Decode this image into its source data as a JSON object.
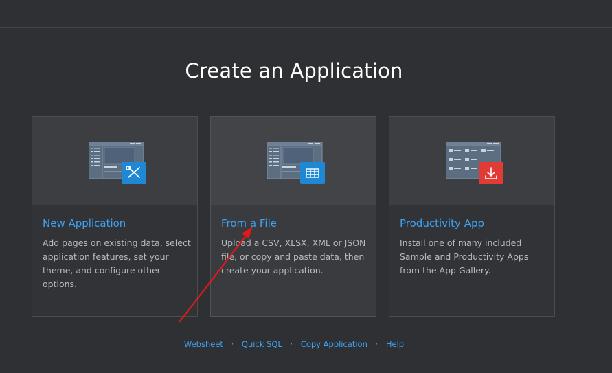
{
  "page": {
    "title": "Create an Application"
  },
  "cards": [
    {
      "title": "New Application",
      "description": "Add pages on existing data, select application features, set your theme, and configure other options.",
      "icon": "pencil-ruler-icon",
      "badge_color": "#1e88d4"
    },
    {
      "title": "From a File",
      "description": "Upload a CSV, XLSX, XML or JSON file, or copy and paste data, then create your application.",
      "icon": "table-grid-icon",
      "badge_color": "#1e88d4"
    },
    {
      "title": "Productivity App",
      "description": "Install one of many included Sample and Productivity Apps from the App Gallery.",
      "icon": "download-icon",
      "badge_color": "#e03b35"
    }
  ],
  "footer": {
    "links": [
      "Websheet",
      "Quick SQL",
      "Copy Application",
      "Help"
    ],
    "separator": "·"
  },
  "colors": {
    "background": "#2f3033",
    "link": "#3ea2f2",
    "annotation_arrow": "#e01919"
  }
}
